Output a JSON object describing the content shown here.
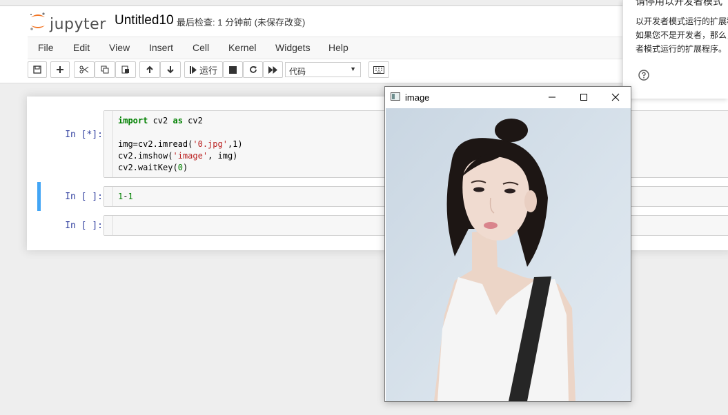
{
  "app": {
    "logo_text": "jupyter",
    "notebook_title": "Untitled10",
    "status": "最后检查: 1 分钟前  (未保存改变)"
  },
  "menu": [
    "File",
    "Edit",
    "View",
    "Insert",
    "Cell",
    "Kernel",
    "Widgets",
    "Help"
  ],
  "toolbar": {
    "run_label": "运行",
    "cell_type": "代码"
  },
  "cells": [
    {
      "prompt": "In  [*]:",
      "lines": [
        [
          [
            "kw",
            "import"
          ],
          [
            "",
            " cv2 "
          ],
          [
            "kw",
            "as"
          ],
          [
            "",
            " cv2"
          ]
        ],
        [],
        [
          [
            "",
            "img=cv2.imread("
          ],
          [
            "str",
            "'0.jpg'"
          ],
          [
            "",
            ",1)"
          ]
        ],
        [
          [
            "",
            "cv2.imshow("
          ],
          [
            "str",
            "'image'"
          ],
          [
            "",
            ", img)"
          ]
        ],
        [
          [
            "",
            "cv2.waitKey("
          ],
          [
            "num",
            "0"
          ],
          [
            "",
            ")"
          ]
        ]
      ]
    },
    {
      "prompt": "In  [ ]:",
      "lines": [
        [
          [
            "num",
            "1"
          ],
          [
            "",
            "-"
          ],
          [
            "num",
            "1"
          ]
        ]
      ]
    },
    {
      "prompt": "In  [ ]:",
      "lines": []
    }
  ],
  "notification": {
    "title": "请停用以开发者模式",
    "body_lines": [
      "以开发者模式运行的扩展程",
      "如果您不是开发者，那么，",
      "者模式运行的扩展程序。"
    ],
    "help_icon": "help-circle-icon"
  },
  "image_window": {
    "title": "image",
    "minimize_icon": "minimize-icon",
    "maximize_icon": "maximize-icon",
    "close_icon": "close-icon"
  },
  "colors": {
    "jupyter_orange": "#f37726",
    "prompt_blue": "#303f9f",
    "selected_cell": "#42a5f5",
    "keyword_green": "#008000",
    "string_red": "#ba2121"
  }
}
